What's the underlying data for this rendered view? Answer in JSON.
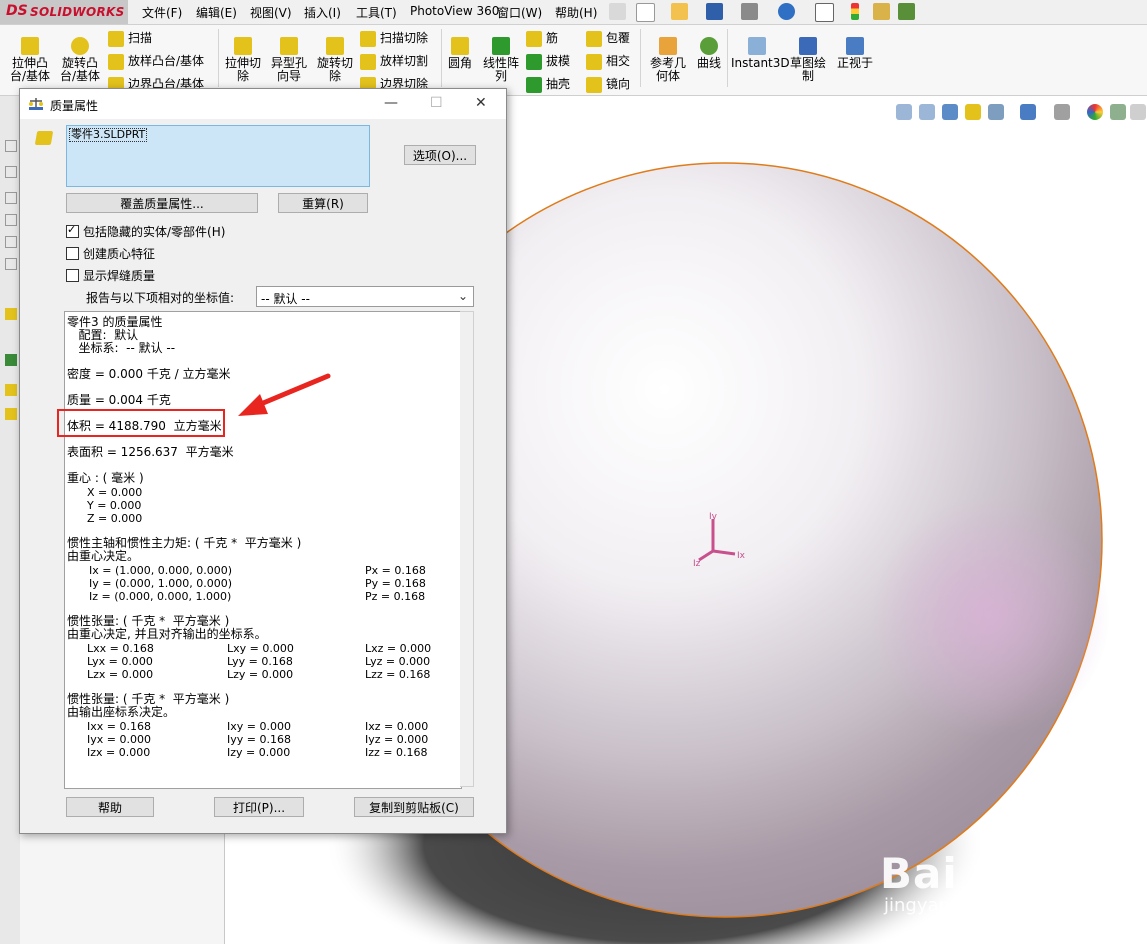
{
  "app": {
    "logo_prefix": "DS",
    "logo_text": "SOLIDWORKS"
  },
  "menu": [
    "文件(F)",
    "编辑(E)",
    "视图(V)",
    "插入(I)",
    "工具(T)",
    "PhotoView 360",
    "窗口(W)",
    "帮助(H)"
  ],
  "ribbon": {
    "extrude_boss": "拉伸凸\n台/基体",
    "revolve_boss": "旋转凸\n台/基体",
    "sweep": "扫描",
    "loft_boss": "放样凸台/基体",
    "boundary_boss": "边界凸台/基体",
    "extrude_cut": "拉伸切\n除",
    "hole_wizard": "异型孔\n向导",
    "revolve_cut": "旋转切\n除",
    "swept_cut": "扫描切除",
    "lofted_cut": "放样切割",
    "boundary_cut": "边界切除",
    "fillet": "圆角",
    "linear_pattern": "线性阵\n列",
    "rib": "筋",
    "draft": "拔模",
    "shell": "抽壳",
    "wrap": "包覆",
    "intersect": "相交",
    "mirror": "镜向",
    "ref_geometry": "参考几\n何体",
    "curves": "曲线",
    "instant3d": "Instant3D",
    "sketch": "草图绘\n制",
    "normal_to": "正视于"
  },
  "dialog": {
    "title": "质量属性",
    "selection_item": "零件3.SLDPRT",
    "options_button": "选项(O)...",
    "override_button": "覆盖质量属性...",
    "recalc_button": "重算(R)",
    "include_hidden": "包括隐藏的实体/零部件(H)",
    "create_cm": "创建质心特征",
    "show_weld": "显示焊缝质量",
    "report_coord_label": "报告与以下项相对的坐标值:",
    "report_coord_value": "-- 默认 --",
    "help_button": "帮助",
    "print_button": "打印(P)...",
    "copy_button": "复制到剪贴板(C)"
  },
  "results": {
    "header": "零件3 的质量属性",
    "config": "   配置:  默认",
    "coordsys": "   坐标系:  -- 默认 --",
    "density": "密度 = 0.000 千克 / 立方毫米",
    "mass": "质量 = 0.004 千克",
    "volume": "体积 = 4188.790  立方毫米",
    "surface_area": "表面积 = 1256.637  平方毫米",
    "cog_title": "重心 : ( 毫米 )",
    "cog_x": "X = 0.000",
    "cog_y": "Y = 0.000",
    "cog_z": "Z = 0.000",
    "principal_title": "惯性主轴和惯性主力矩: ( 千克 *  平方毫米 )",
    "principal_sub": "由重心决定。",
    "ix": "Ix = (1.000, 0.000, 0.000)",
    "iy": "Iy = (0.000, 1.000, 0.000)",
    "iz": "Iz = (0.000, 0.000, 1.000)",
    "px": "Px = 0.168",
    "py": "Py = 0.168",
    "pz": "Pz = 0.168",
    "tensor1_title": "惯性张量: ( 千克 *  平方毫米 )",
    "tensor1_sub": "由重心决定, 并且对齐输出的坐标系。",
    "lxx": "Lxx = 0.168",
    "lxy": "Lxy = 0.000",
    "lxz": "Lxz = 0.000",
    "lyx": "Lyx = 0.000",
    "lyy": "Lyy = 0.168",
    "lyz": "Lyz = 0.000",
    "lzx": "Lzx = 0.000",
    "lzy": "Lzy = 0.000",
    "lzz": "Lzz = 0.168",
    "tensor2_title": "惯性张量: ( 千克 *  平方毫米 )",
    "tensor2_sub": "由输出座标系决定。",
    "ixx": "Ixx = 0.168",
    "ixy": "Ixy = 0.000",
    "ixz": "Ixz = 0.000",
    "iyx": "Iyx = 0.000",
    "iyy": "Iyy = 0.168",
    "iyz": "Iyz = 0.000",
    "izx": "Izx = 0.000",
    "izy": "Izy = 0.000",
    "izz": "Izz = 0.168"
  },
  "triad": {
    "x": "Ix",
    "y": "Iy",
    "z": "Iz"
  },
  "watermark": {
    "brand": "Bai 经验",
    "url": "jingyan.baidu.com"
  },
  "colors": {
    "highlight": "#e8261f",
    "sphere_edge": "#e07b1a",
    "triad": "#c8508c"
  }
}
